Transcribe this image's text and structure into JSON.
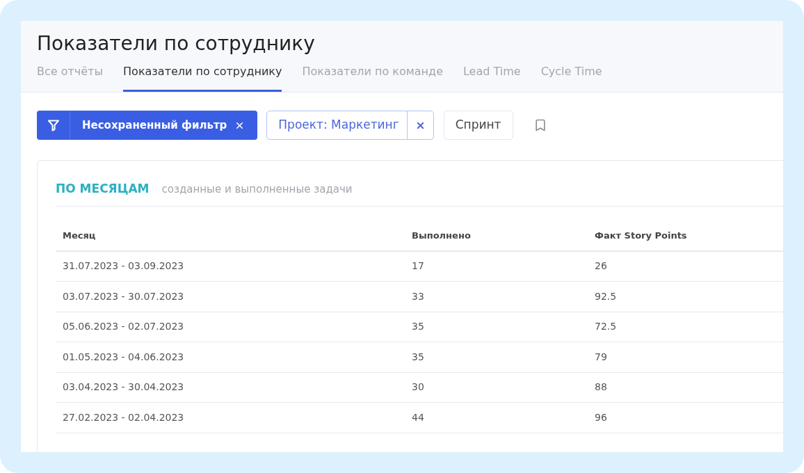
{
  "page": {
    "title": "Показатели по сотруднику"
  },
  "tabs": [
    {
      "label": "Все отчёты",
      "selected": false
    },
    {
      "label": "Показатели по сотруднику",
      "selected": true
    },
    {
      "label": "Показатели по команде",
      "selected": false
    },
    {
      "label": "Lead Time",
      "selected": false
    },
    {
      "label": "Cycle Time",
      "selected": false
    }
  ],
  "filter_bar": {
    "filter_button": {
      "label": "Несохраненный фильтр"
    },
    "chips": [
      {
        "kind": "removable",
        "label": "Проект: Маркетинг"
      },
      {
        "kind": "plain",
        "label": "Спринт"
      }
    ]
  },
  "card": {
    "title": "ПО МЕСЯЦАМ",
    "subtitle": "созданные и выполненные задачи",
    "table": {
      "columns": [
        "Месяц",
        "Выполнено",
        "Факт Story Points"
      ],
      "rows": [
        [
          "31.07.2023 - 03.09.2023",
          "17",
          "26"
        ],
        [
          "03.07.2023 - 30.07.2023",
          "33",
          "92.5"
        ],
        [
          "05.06.2023 - 02.07.2023",
          "35",
          "72.5"
        ],
        [
          "01.05.2023 - 04.06.2023",
          "35",
          "79"
        ],
        [
          "03.04.2023 - 30.04.2023",
          "30",
          "88"
        ],
        [
          "27.02.2023 - 02.04.2023",
          "44",
          "96"
        ]
      ]
    }
  }
}
